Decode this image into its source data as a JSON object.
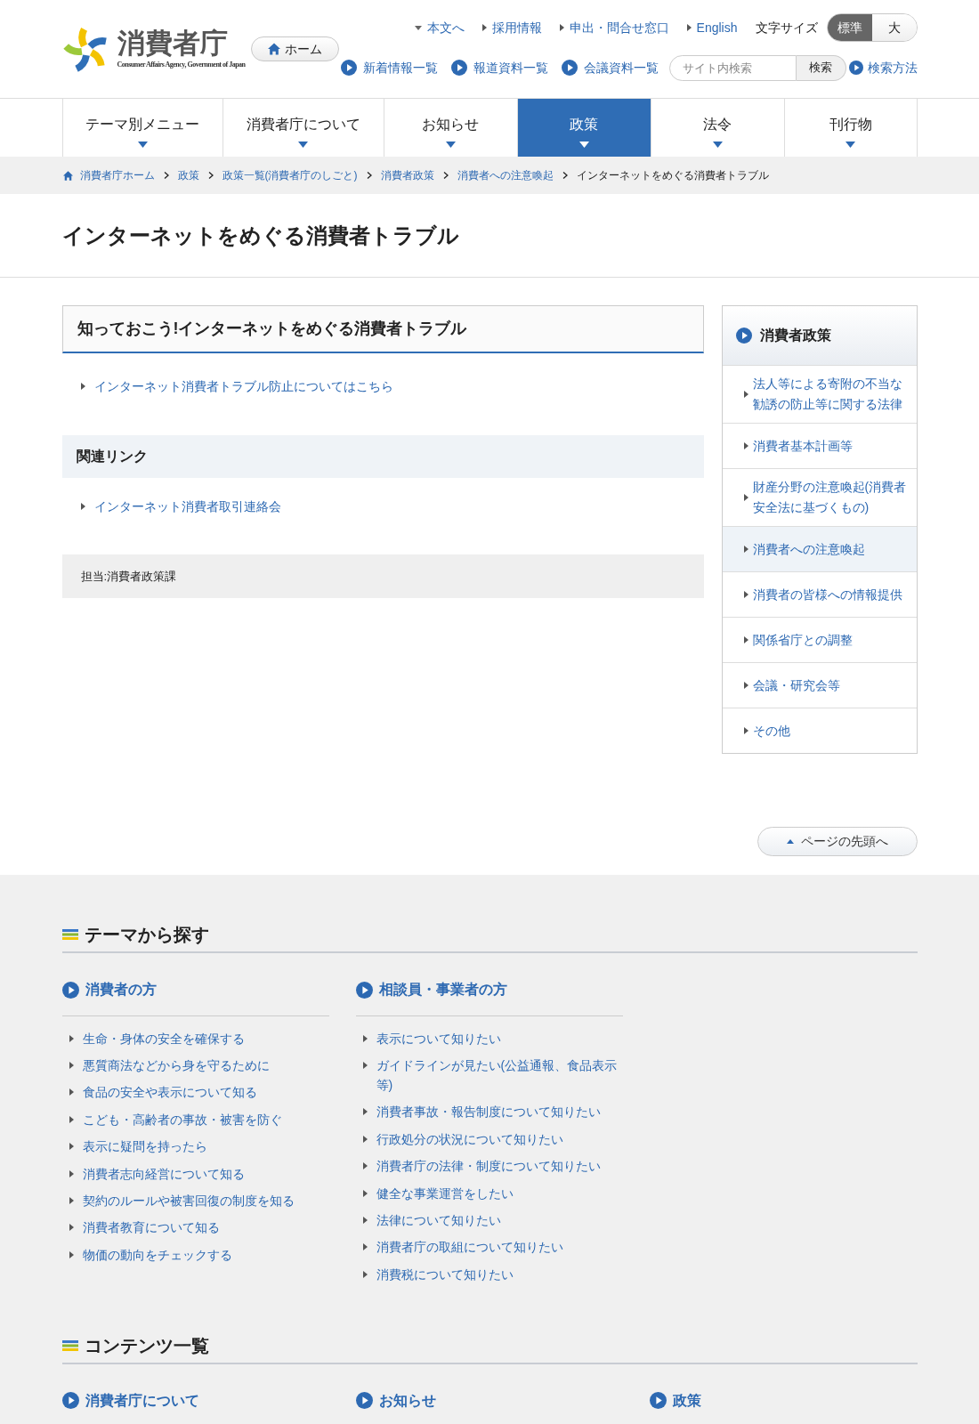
{
  "header": {
    "logo": {
      "name": "消費者庁",
      "subtitle": "Consumer Affairs Agency, Government of Japan"
    },
    "home_button": "ホーム",
    "utility_links": [
      {
        "label": "本文へ",
        "kind": "down"
      },
      {
        "label": "採用情報",
        "kind": "right"
      },
      {
        "label": "申出・問合せ窓口",
        "kind": "right"
      },
      {
        "label": "English",
        "kind": "right"
      }
    ],
    "font_size": {
      "label": "文字サイズ",
      "options": [
        {
          "label": "標準",
          "selected": true
        },
        {
          "label": "大",
          "selected": false
        }
      ]
    },
    "quick_links": [
      "新着情報一覧",
      "報道資料一覧",
      "会議資料一覧"
    ],
    "search": {
      "placeholder": "サイト内検索",
      "button": "検索"
    },
    "search_help": "検索方法"
  },
  "nav": [
    {
      "label": "テーマ別メニュー",
      "selected": false
    },
    {
      "label": "消費者庁について",
      "selected": false
    },
    {
      "label": "お知らせ",
      "selected": false
    },
    {
      "label": "政策",
      "selected": true
    },
    {
      "label": "法令",
      "selected": false
    },
    {
      "label": "刊行物",
      "selected": false
    }
  ],
  "breadcrumb": [
    "消費者庁ホーム",
    "政策",
    "政策一覧(消費者庁のしごと)",
    "消費者政策",
    "消費者への注意喚起",
    "インターネットをめぐる消費者トラブル"
  ],
  "page_title": "インターネットをめぐる消費者トラブル",
  "main": {
    "section_title": "知っておこう!インターネットをめぐる消費者トラブル",
    "links": [
      "インターネット消費者トラブル防止についてはこちら"
    ],
    "related": {
      "title": "関連リンク",
      "links": [
        "インターネット消費者取引連絡会"
      ]
    },
    "contact": "担当:消費者政策課"
  },
  "sidebar": {
    "title": "消費者政策",
    "items": [
      {
        "label": "法人等による寄附の不当な勧誘の防止等に関する法律",
        "selected": false
      },
      {
        "label": "消費者基本計画等",
        "selected": false
      },
      {
        "label": "財産分野の注意喚起(消費者安全法に基づくもの)",
        "selected": false
      },
      {
        "label": "消費者への注意喚起",
        "selected": true
      },
      {
        "label": "消費者の皆様への情報提供",
        "selected": false
      },
      {
        "label": "関係省庁との調整",
        "selected": false
      },
      {
        "label": "会議・研究会等",
        "selected": false
      },
      {
        "label": "その他",
        "selected": false
      }
    ]
  },
  "page_top": "ページの先頭へ",
  "footer": [
    {
      "title": "テーマから探す",
      "columns": [
        {
          "title": "消費者の方",
          "links": [
            "生命・身体の安全を確保する",
            "悪質商法などから身を守るために",
            "食品の安全や表示について知る",
            "こども・高齢者の事故・被害を防ぐ",
            "表示に疑問を持ったら",
            "消費者志向経営について知る",
            "契約のルールや被害回復の制度を知る",
            "消費者教育について知る",
            "物価の動向をチェックする"
          ]
        },
        {
          "title": "相談員・事業者の方",
          "links": [
            "表示について知りたい",
            "ガイドラインが見たい(公益通報、食品表示等)",
            "消費者事故・報告制度について知りたい",
            "行政処分の状況について知りたい",
            "消費者庁の法律・制度について知りたい",
            "健全な事業運営をしたい",
            "法律について知りたい",
            "消費者庁の取組について知りたい",
            "消費税について知りたい"
          ]
        }
      ]
    },
    {
      "title": "コンテンツ一覧",
      "columns": [
        {
          "title": "消費者庁について"
        },
        {
          "title": "お知らせ"
        },
        {
          "title": "政策"
        }
      ]
    }
  ]
}
